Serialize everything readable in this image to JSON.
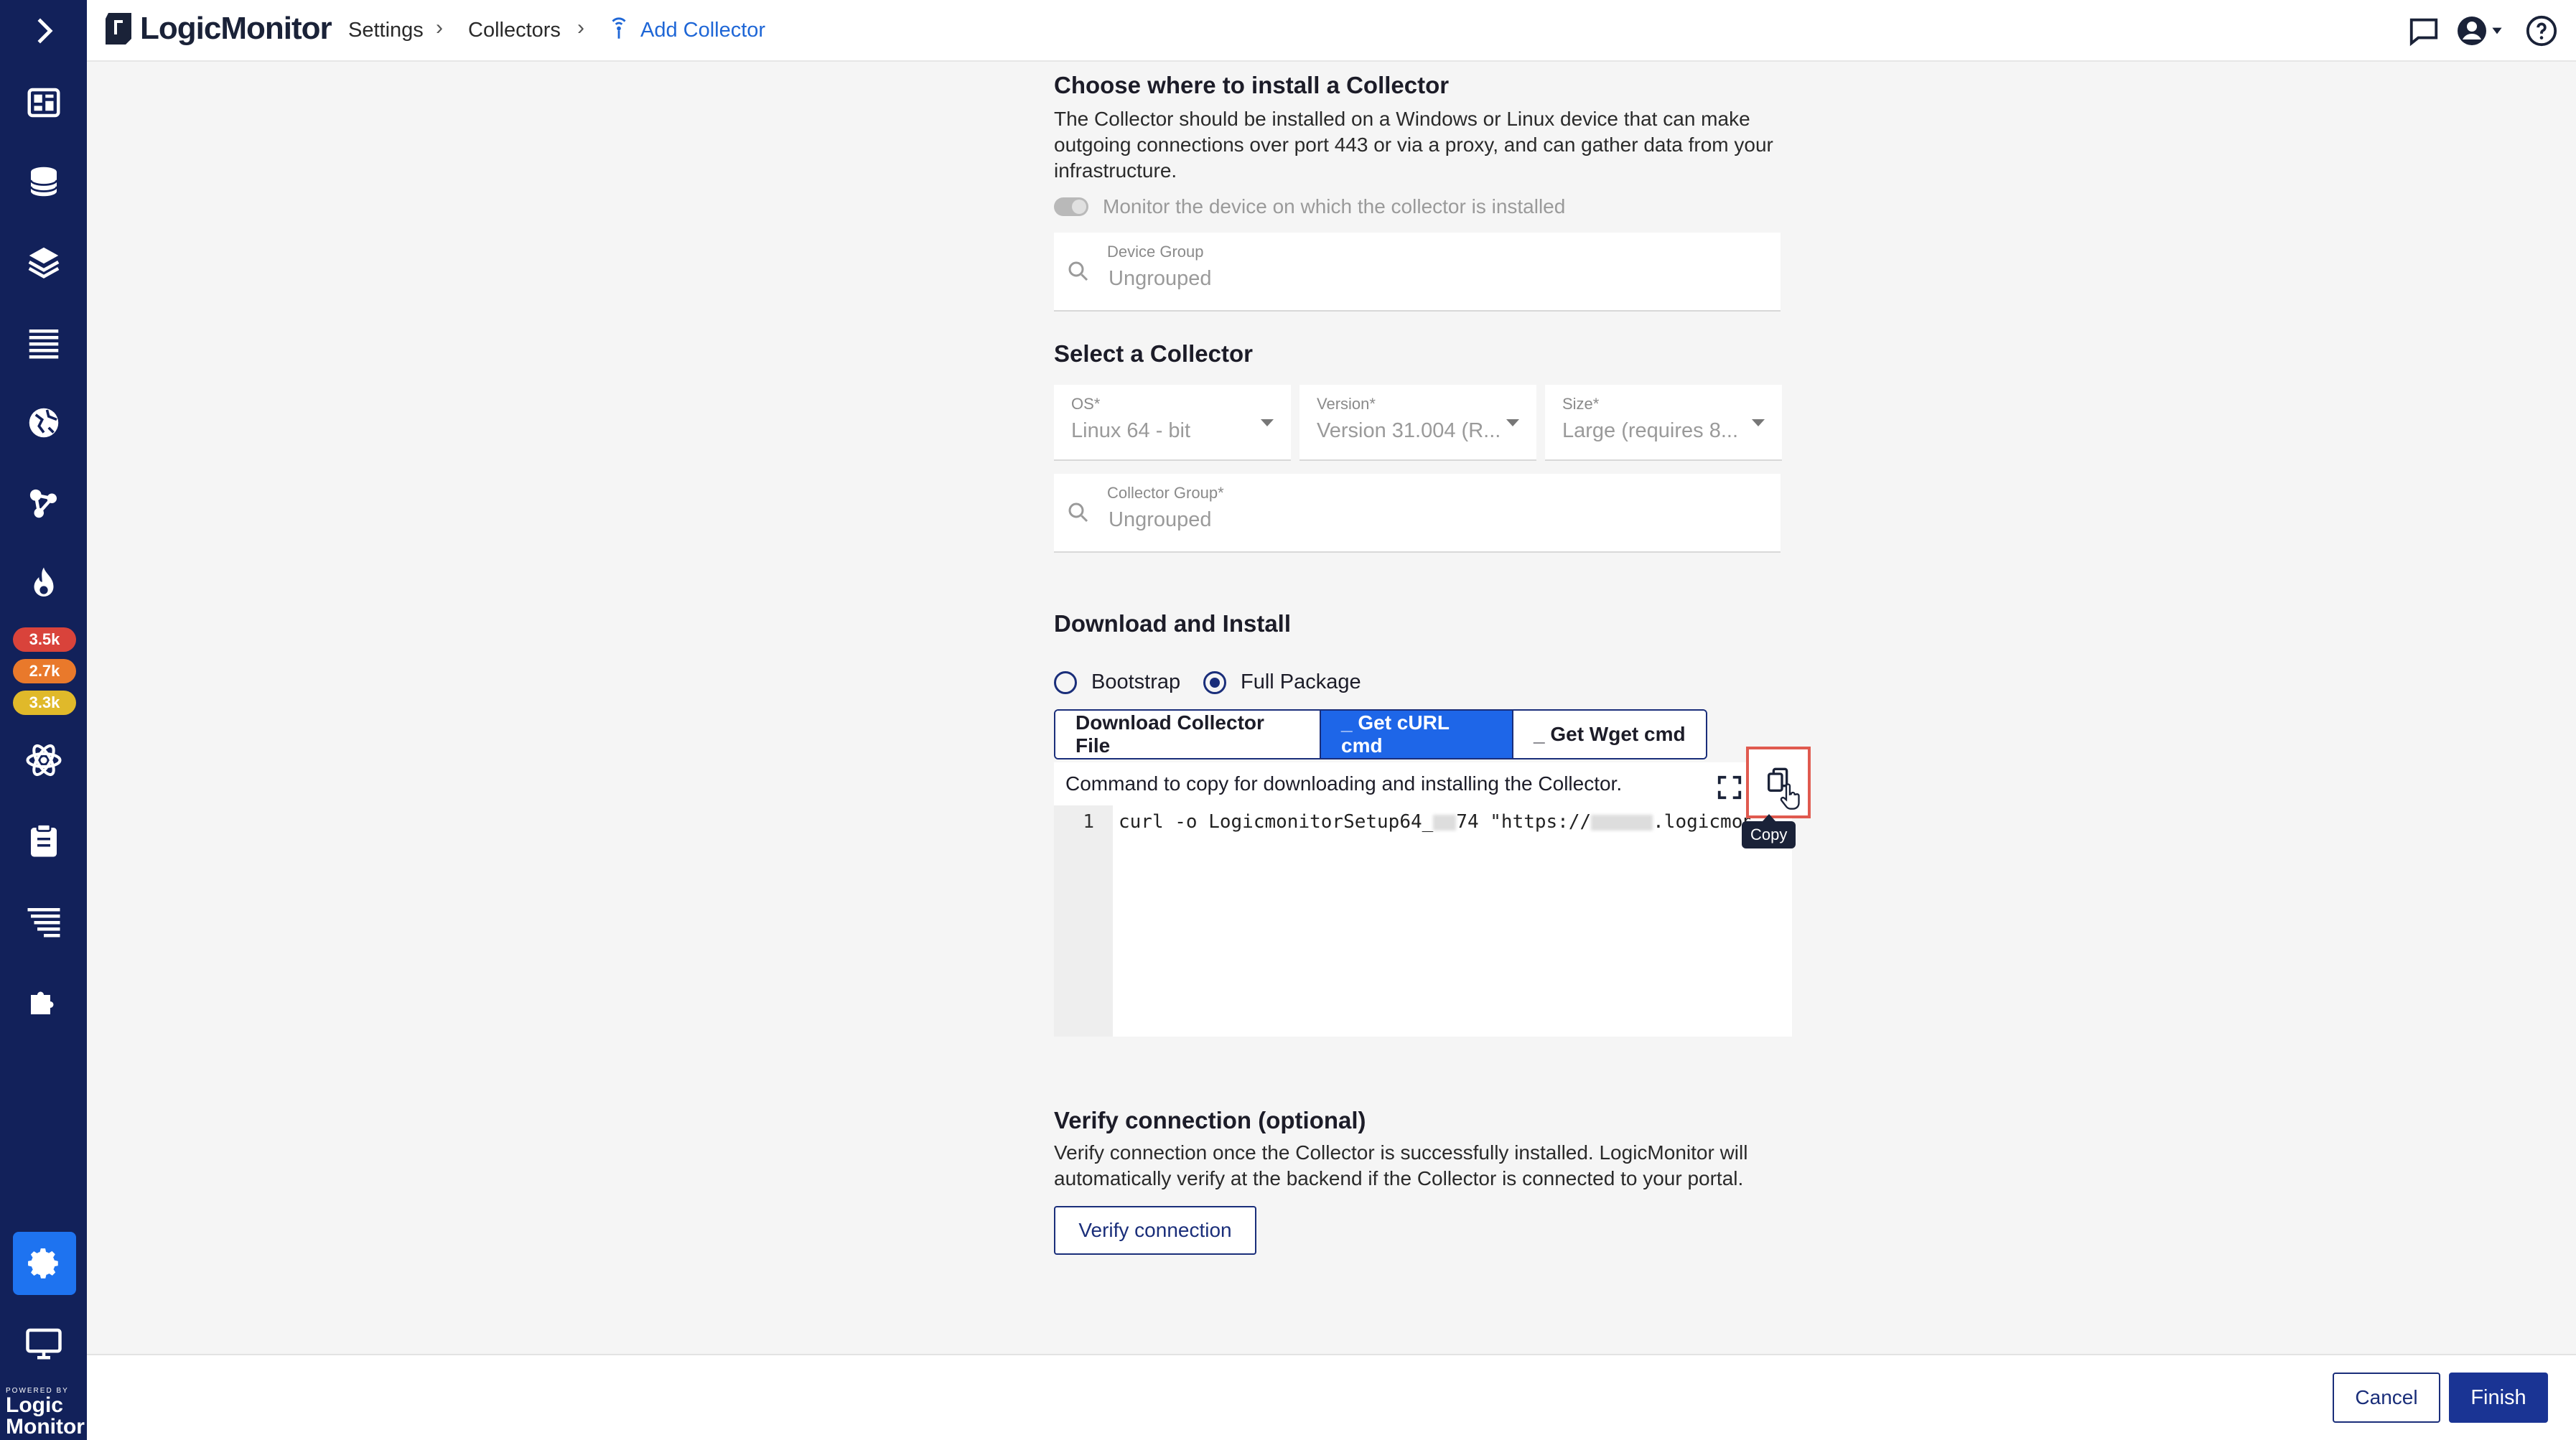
{
  "colors": {
    "sidebar_bg": "#12215a",
    "accent": "#1e66e8",
    "primary_button": "#1a3494",
    "badge_red": "#d9433b",
    "badge_orange": "#e9792b",
    "badge_yellow": "#e0b92a",
    "highlight": "#e05a4f"
  },
  "sidebar": {
    "items": [
      {
        "icon": "dashboards-icon"
      },
      {
        "icon": "database-icon"
      },
      {
        "icon": "layers-icon"
      },
      {
        "icon": "list-icon"
      },
      {
        "icon": "globe-icon"
      },
      {
        "icon": "topology-icon"
      },
      {
        "icon": "flame-icon"
      },
      {
        "icon": "atom-icon"
      },
      {
        "icon": "clipboard-icon"
      },
      {
        "icon": "filter-list-icon"
      },
      {
        "icon": "puzzle-icon"
      },
      {
        "icon": "settings-gear-icon"
      },
      {
        "icon": "monitor-icon"
      }
    ],
    "badges": [
      "3.5k",
      "2.7k",
      "3.3k"
    ],
    "powered_by": "POWERED BY",
    "powered_logo": "Logic Monitor"
  },
  "header": {
    "logo_text": "LogicMonitor",
    "breadcrumb": [
      "Settings",
      "Collectors",
      "Add Collector"
    ]
  },
  "install": {
    "title": "Choose where to install a Collector",
    "description": "The Collector should be installed on a Windows or Linux device that can make outgoing connections over port 443 or via a proxy, and can gather data from your infrastructure.",
    "monitor_toggle_label": "Monitor the device on which the collector is installed",
    "device_group_label": "Device Group",
    "device_group_value": "Ungrouped"
  },
  "select": {
    "title": "Select a Collector",
    "os_label": "OS*",
    "os_value": "Linux 64 - bit",
    "version_label": "Version*",
    "version_value": "Version 31.004 (R...",
    "size_label": "Size*",
    "size_value": "Large (requires 8...",
    "group_label": "Collector Group*",
    "group_value": "Ungrouped"
  },
  "download": {
    "title": "Download and Install",
    "radio_bootstrap": "Bootstrap",
    "radio_full": "Full Package",
    "tabs": [
      "Download Collector File",
      "_ Get cURL cmd",
      "_ Get Wget cmd"
    ],
    "command_caption": "Command to copy for downloading and installing the Collector.",
    "line_number": "1",
    "code_part1": "curl -o LogicmonitorSetup64_",
    "code_part2": "74 \"https://",
    "code_part3": ".logicmonit",
    "copy_tooltip": "Copy"
  },
  "verify": {
    "title": "Verify connection (optional)",
    "description": "Verify connection once the Collector is successfully installed. LogicMonitor will automatically verify at the backend if the Collector is connected to your portal.",
    "button": "Verify connection"
  },
  "footer": {
    "cancel": "Cancel",
    "finish": "Finish"
  }
}
